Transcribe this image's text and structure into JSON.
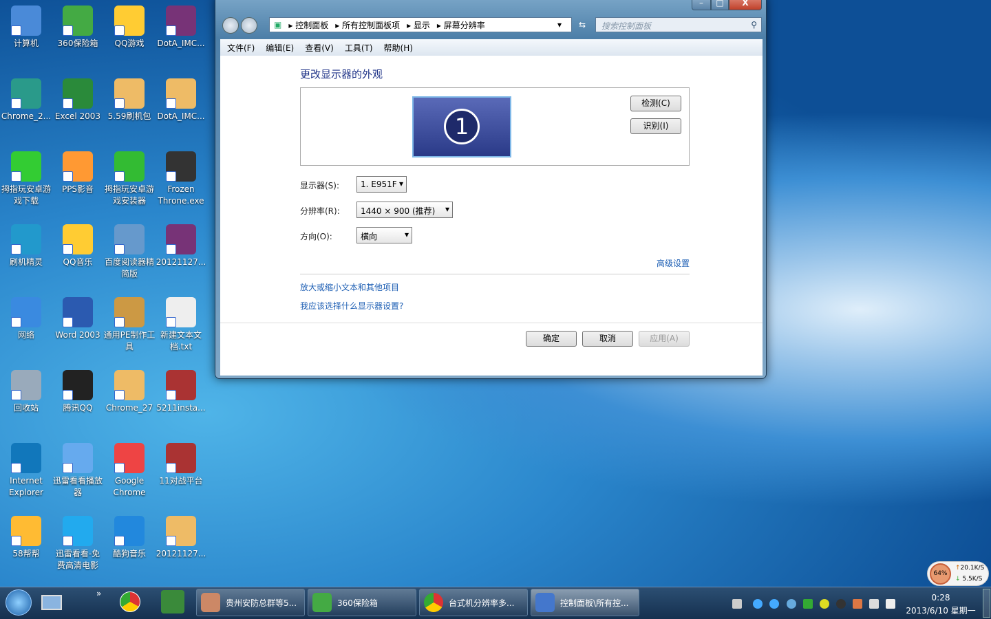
{
  "desktop": {
    "icons": [
      [
        "计算机",
        "Chrome_2...",
        "拇指玩安卓游戏下载",
        "刷机精灵",
        "网络",
        "回收站",
        "Internet Explorer",
        "58帮帮"
      ],
      [
        "360保险箱",
        "Excel 2003",
        "PPS影音",
        "QQ音乐",
        "Word 2003",
        "腾讯QQ",
        "迅雷看看播放器",
        "迅雷看看-免费高清电影"
      ],
      [
        "QQ游戏",
        "5.59刷机包",
        "拇指玩安卓游戏安装器",
        "百度阅读器精简版",
        "通用PE制作工具",
        "Chrome_27",
        "Google Chrome",
        "酷狗音乐"
      ],
      [
        "DotA_IMC...",
        "DotA_IMC...",
        "Frozen Throne.exe",
        "20121127...",
        "新建文本文档.txt",
        "5211insta...",
        "11对战平台",
        "20121127..."
      ]
    ]
  },
  "window": {
    "controls": {
      "minimize": "–",
      "maximize": "□",
      "close": "X"
    },
    "breadcrumb": [
      "控制面板",
      "所有控制面板项",
      "显示",
      "屏幕分辨率"
    ],
    "search_placeholder": "搜索控制面板",
    "menu": [
      "文件(F)",
      "编辑(E)",
      "查看(V)",
      "工具(T)",
      "帮助(H)"
    ],
    "title": "更改显示器的外观",
    "monitor_number": "1",
    "detect": "检测(C)",
    "identify": "识别(I)",
    "display_label": "显示器(S):",
    "display_value": "1. E951F",
    "resolution_label": "分辨率(R):",
    "resolution_value": "1440 × 900 (推荐)",
    "orientation_label": "方向(O):",
    "orientation_value": "横向",
    "advanced": "高级设置",
    "link1": "放大或缩小文本和其他项目",
    "link2": "我应该选择什么显示器设置?",
    "ok": "确定",
    "cancel": "取消",
    "apply": "应用(A)"
  },
  "taskbar": {
    "overflow": "»",
    "tasks": [
      "贵州安防总群等5...",
      "360保险箱",
      "台式机分辨率多...",
      "控制面板\\所有控..."
    ],
    "time": "0:28",
    "date": "2013/6/10 星期一"
  },
  "netmeter": {
    "cpu": "64%",
    "up": "20.1K/S",
    "down": "5.5K/S"
  }
}
